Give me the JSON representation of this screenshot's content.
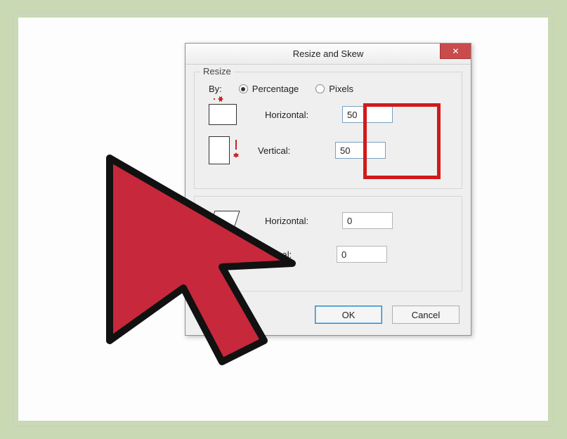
{
  "dialog": {
    "title": "Resize and Skew",
    "close_glyph": "✕"
  },
  "resize": {
    "group_title": "Resize",
    "by_label": "By:",
    "percentage_label": "Percentage",
    "pixels_label": "Pixels",
    "selected": "Percentage",
    "horizontal_label": "Horizontal:",
    "vertical_label": "Vertical:",
    "horizontal_value": "50",
    "vertical_value": "50"
  },
  "skew": {
    "horizontal_label": "Horizontal:",
    "vertical_label": "Vertical:",
    "horizontal_value": "0",
    "vertical_value": "0"
  },
  "buttons": {
    "ok": "OK",
    "cancel": "Cancel"
  },
  "colors": {
    "highlight": "#d11a1a"
  }
}
